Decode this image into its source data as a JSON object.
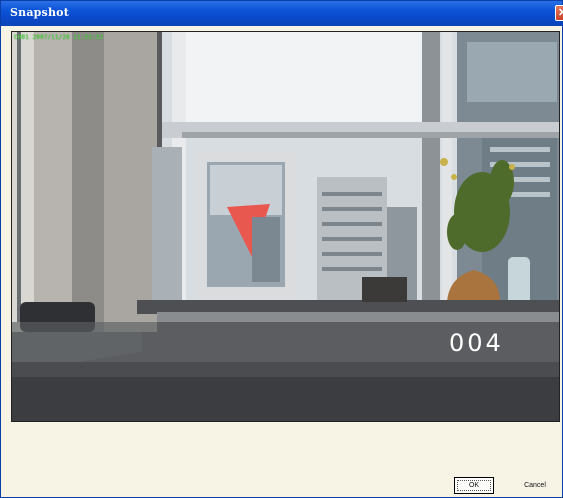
{
  "window": {
    "title": "Snapshot",
    "close_glyph": "✕"
  },
  "video": {
    "timestamp": "CH01 2007/11/28 11:53:32",
    "camera_number": "004"
  },
  "buttons": {
    "ok_label": "OK",
    "cancel_label": "Cancel"
  }
}
